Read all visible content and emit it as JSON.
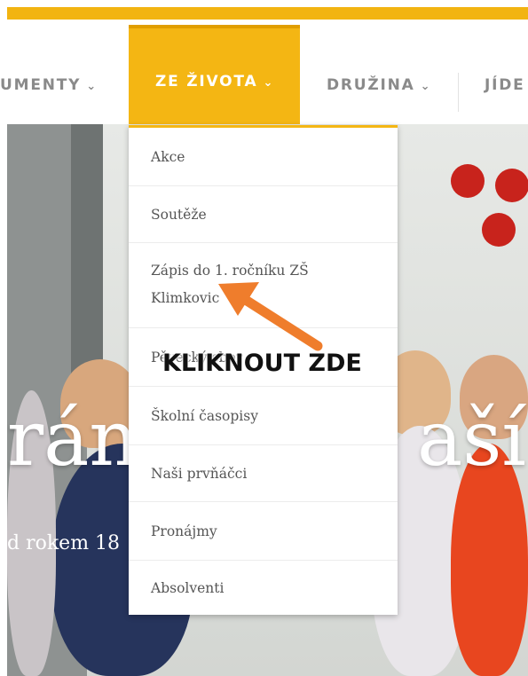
{
  "nav": {
    "items": [
      {
        "label": "UMENTY",
        "active": false
      },
      {
        "label": "ZE ŽIVOTA",
        "active": true
      },
      {
        "label": "DRUŽINA",
        "active": false
      },
      {
        "label": "JÍDE",
        "active": false
      }
    ],
    "chevron_icon": "chevron-down-icon",
    "accent_color": "#f4b613"
  },
  "hero": {
    "title_left": "rán",
    "title_right": "aší",
    "subtitle": "d rokem 18"
  },
  "dropdown": {
    "items": [
      "Akce",
      "Soutěže",
      "Zápis do 1. ročníku ZŠ",
      "Klimkovic",
      "Pěvecký sbor",
      "Školní časopisy",
      "Naši prvňáčci",
      "Pronájmy",
      "Absolventi"
    ]
  },
  "annotation": {
    "callout": "KLIKNOUT ZDE",
    "arrow_color": "#ef7d2c"
  }
}
